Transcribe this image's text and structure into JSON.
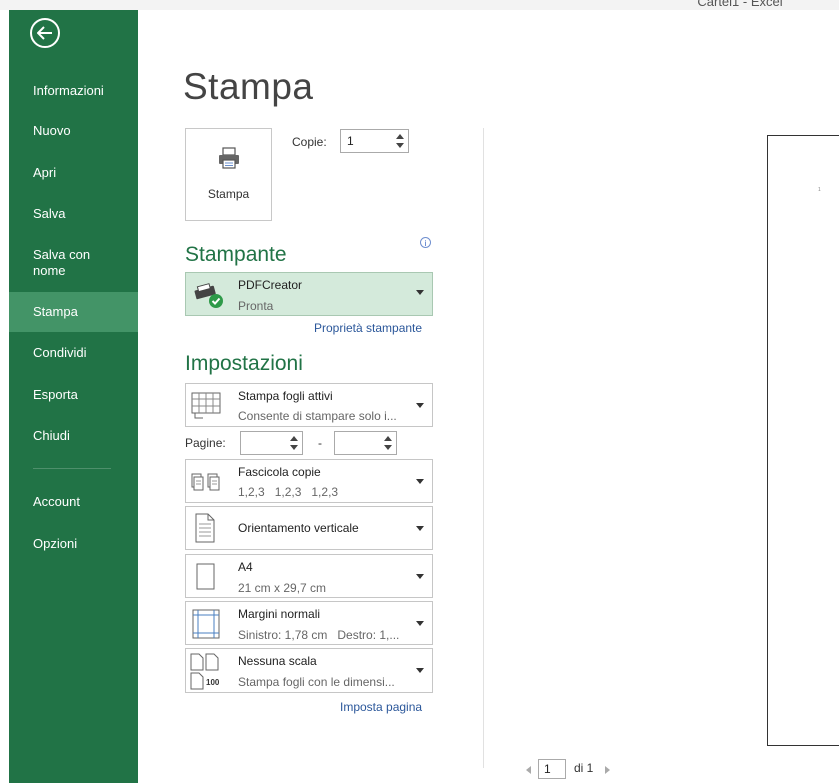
{
  "window": {
    "title": "Cartel1 - Excel"
  },
  "sidebar": {
    "items": [
      {
        "label": "Informazioni"
      },
      {
        "label": "Nuovo"
      },
      {
        "label": "Apri"
      },
      {
        "label": "Salva"
      },
      {
        "label": "Salva con nome"
      },
      {
        "label": "Stampa",
        "active": true
      },
      {
        "label": "Condividi"
      },
      {
        "label": "Esporta"
      },
      {
        "label": "Chiudi"
      },
      {
        "label": "Account"
      },
      {
        "label": "Opzioni"
      }
    ]
  },
  "print": {
    "title": "Stampa",
    "button_label": "Stampa",
    "copies_label": "Copie:",
    "copies_value": "1"
  },
  "printer": {
    "section_title": "Stampante",
    "name": "PDFCreator",
    "status": "Pronta",
    "properties_link": "Proprietà stampante"
  },
  "settings": {
    "section_title": "Impostazioni",
    "what": {
      "title": "Stampa fogli attivi",
      "subtitle": "Consente di stampare solo i..."
    },
    "pages_label": "Pagine:",
    "pages_from": "",
    "pages_to": "",
    "pages_dash": "-",
    "collate": {
      "title": "Fascicola copie",
      "subtitle": "1,2,3   1,2,3   1,2,3"
    },
    "orientation": {
      "title": "Orientamento verticale"
    },
    "paper": {
      "title": "A4",
      "subtitle": "21 cm x 29,7 cm"
    },
    "margins": {
      "title": "Margini normali",
      "subtitle": "Sinistro: 1,78 cm   Destro: 1,..."
    },
    "scaling": {
      "title": "Nessuna scala",
      "subtitle": "Stampa fogli con le dimensi...",
      "icon_text": "100"
    },
    "page_setup_link": "Imposta pagina"
  },
  "preview": {
    "current_page": "1",
    "total_label": "di 1",
    "mark": "1"
  },
  "colors": {
    "accent": "#217346",
    "sidebar_active": "#439467",
    "printer_bg": "#d4eadb",
    "link": "#2b579a"
  }
}
